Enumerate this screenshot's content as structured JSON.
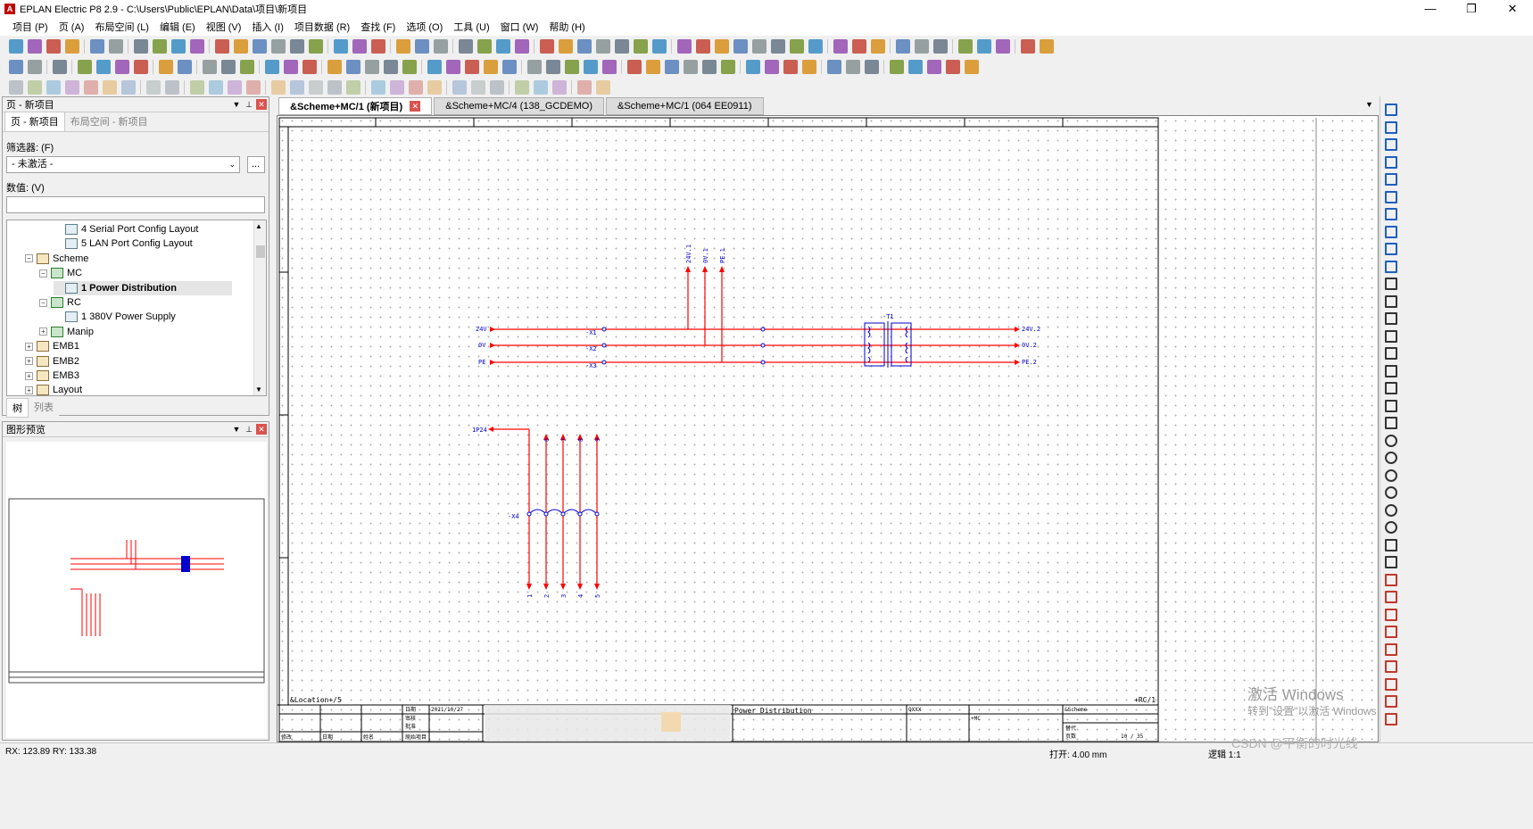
{
  "window": {
    "title": "EPLAN Electric P8 2.9 - C:\\Users\\Public\\EPLAN\\Data\\项目\\新项目",
    "logo_text": "A",
    "min": "—",
    "max": "❐",
    "close": "✕"
  },
  "menu": [
    "项目 (P)",
    "页 (A)",
    "布局空间 (L)",
    "编辑 (E)",
    "视图 (V)",
    "插入 (I)",
    "项目数据 (R)",
    "查找 (F)",
    "选项 (O)",
    "工具 (U)",
    "窗口 (W)",
    "帮助 (H)"
  ],
  "pages_panel": {
    "title": "页 - 新项目",
    "tab_active": "页 - 新项目",
    "tab_inactive": "布局空间 - 新项目",
    "filter_label": "筛选器: (F)",
    "filter_value": "- 未激活 -",
    "filter_button": "...",
    "value_label": "数值: (V)",
    "tree": [
      {
        "label": "4 Serial Port Config Layout",
        "level": 4,
        "icon": "page",
        "exp": ""
      },
      {
        "label": "5 LAN Port Config Layout",
        "level": 4,
        "icon": "page",
        "exp": ""
      },
      {
        "label": "Scheme",
        "level": 2,
        "icon": "function",
        "exp": "−"
      },
      {
        "label": "MC",
        "level": 3,
        "icon": "location",
        "exp": "−"
      },
      {
        "label": "1 Power Distribution",
        "level": 4,
        "icon": "page",
        "exp": "",
        "selected": true
      },
      {
        "label": "RC",
        "level": 3,
        "icon": "location",
        "exp": "−"
      },
      {
        "label": "1 380V Power Supply",
        "level": 4,
        "icon": "page",
        "exp": ""
      },
      {
        "label": "Manip",
        "level": 3,
        "icon": "location",
        "exp": "+"
      },
      {
        "label": "EMB1",
        "level": 2,
        "icon": "function",
        "exp": "+"
      },
      {
        "label": "EMB2",
        "level": 2,
        "icon": "function",
        "exp": "+"
      },
      {
        "label": "EMB3",
        "level": 2,
        "icon": "function",
        "exp": "+"
      },
      {
        "label": "Layout",
        "level": 2,
        "icon": "function",
        "exp": "+"
      }
    ],
    "bottom_tab_active": "树",
    "bottom_tab_inactive": "列表"
  },
  "preview_panel": {
    "title": "图形预览"
  },
  "doc_tabs": [
    {
      "label": "&Scheme+MC/1 (新项目)",
      "active": true
    },
    {
      "label": "&Scheme+MC/4 (138_GCDEMO)",
      "active": false
    },
    {
      "label": "&Scheme+MC/1 (064 EE0911)",
      "active": false
    }
  ],
  "schematic": {
    "bus_labels_left": [
      "24V",
      "0V",
      "PE"
    ],
    "bus_labels_right": [
      "24V.2",
      "0V.2",
      "PE.2"
    ],
    "vertical_labels": [
      "24V.1",
      "0V.1",
      "PE.1"
    ],
    "terminal_labels": [
      "-X1",
      "-X2",
      "-X3"
    ],
    "transformer_label": "-T1",
    "signal_label": "1P24",
    "terminal_strip_label": "-X4",
    "strip_top_labels": [
      "6",
      "7",
      "8",
      "9"
    ],
    "strip_bottom_labels": [
      "1",
      "2",
      "3",
      "4",
      "5"
    ],
    "location_label": "&Location+/5",
    "page_ref": "+RC/1",
    "titleblock": {
      "date": "2021/10/27",
      "page_title": "Power Distribution",
      "project_code": "QXXX",
      "scheme": "&Scheme",
      "location": "+MC",
      "page_counter": "10 / 35",
      "labels": [
        "日期",
        "审核",
        "批准",
        "修改",
        "日期",
        "姓名",
        "原始项目",
        "替代",
        "页数"
      ]
    }
  },
  "statusbar": {
    "coords": "RX: 123.89    RY: 133.38",
    "grid": "打开: 4.00 mm",
    "logic": "逻辑 1:1",
    "watermark": "CSDN @平衡的时光线"
  },
  "activation": {
    "line1": "激活 Windows",
    "line2": "转到\"设置\"以激活 Windows"
  },
  "colors": {
    "wire": "#ff0000",
    "text_blue": "#0000cc",
    "accent_red": "#c00000"
  }
}
